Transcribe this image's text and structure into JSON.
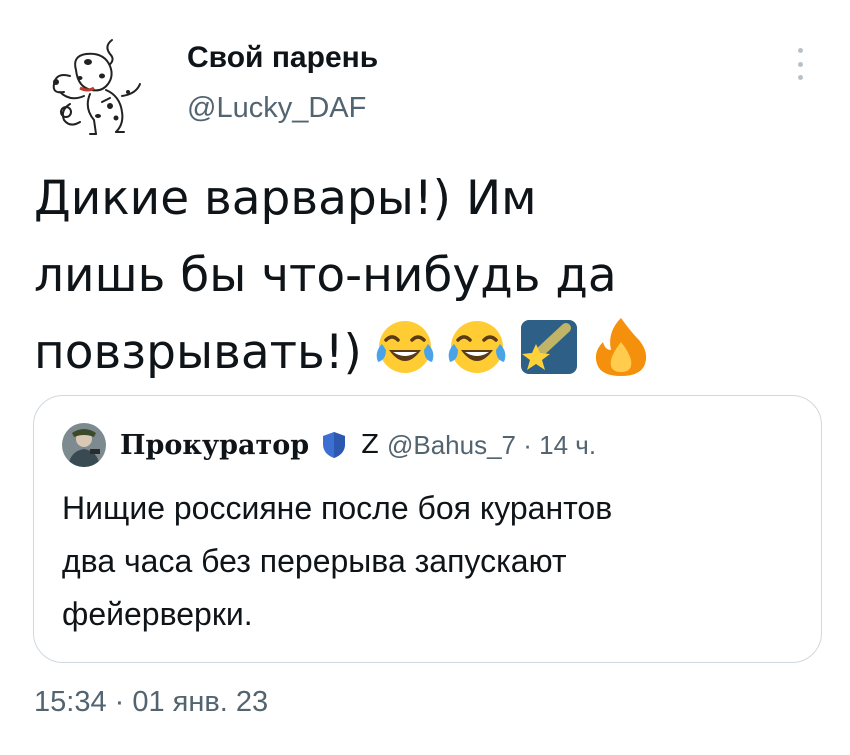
{
  "author": {
    "display_name": "Свой парень",
    "handle": "@Lucky_DAF",
    "avatar_icon": "dalmatian-puppy-avatar"
  },
  "tweet": {
    "text_lines": [
      "Дикие варвары!) Им",
      "лишь бы что-нибудь да",
      "повзрывать!)"
    ],
    "emojis": [
      "face-with-tears-of-joy",
      "face-with-tears-of-joy",
      "shooting-star",
      "fire"
    ]
  },
  "quoted_tweet": {
    "display_name": "Прокуратор",
    "badge_icon": "shield-icon",
    "z_symbol": "Z",
    "handle": "@Bahus_7",
    "time": "14 ч.",
    "meta": "@Bahus_7 · 14 ч.",
    "text_lines": [
      "Нищие россияне после боя курантов",
      "два часа без перерыва запускают",
      "фейерверки."
    ]
  },
  "timestamp": "15:34 · 01 янв. 23",
  "colors": {
    "text": "#0f1419",
    "secondary": "#536471",
    "border": "#cfd9de",
    "shield": "#3b6fd1"
  }
}
